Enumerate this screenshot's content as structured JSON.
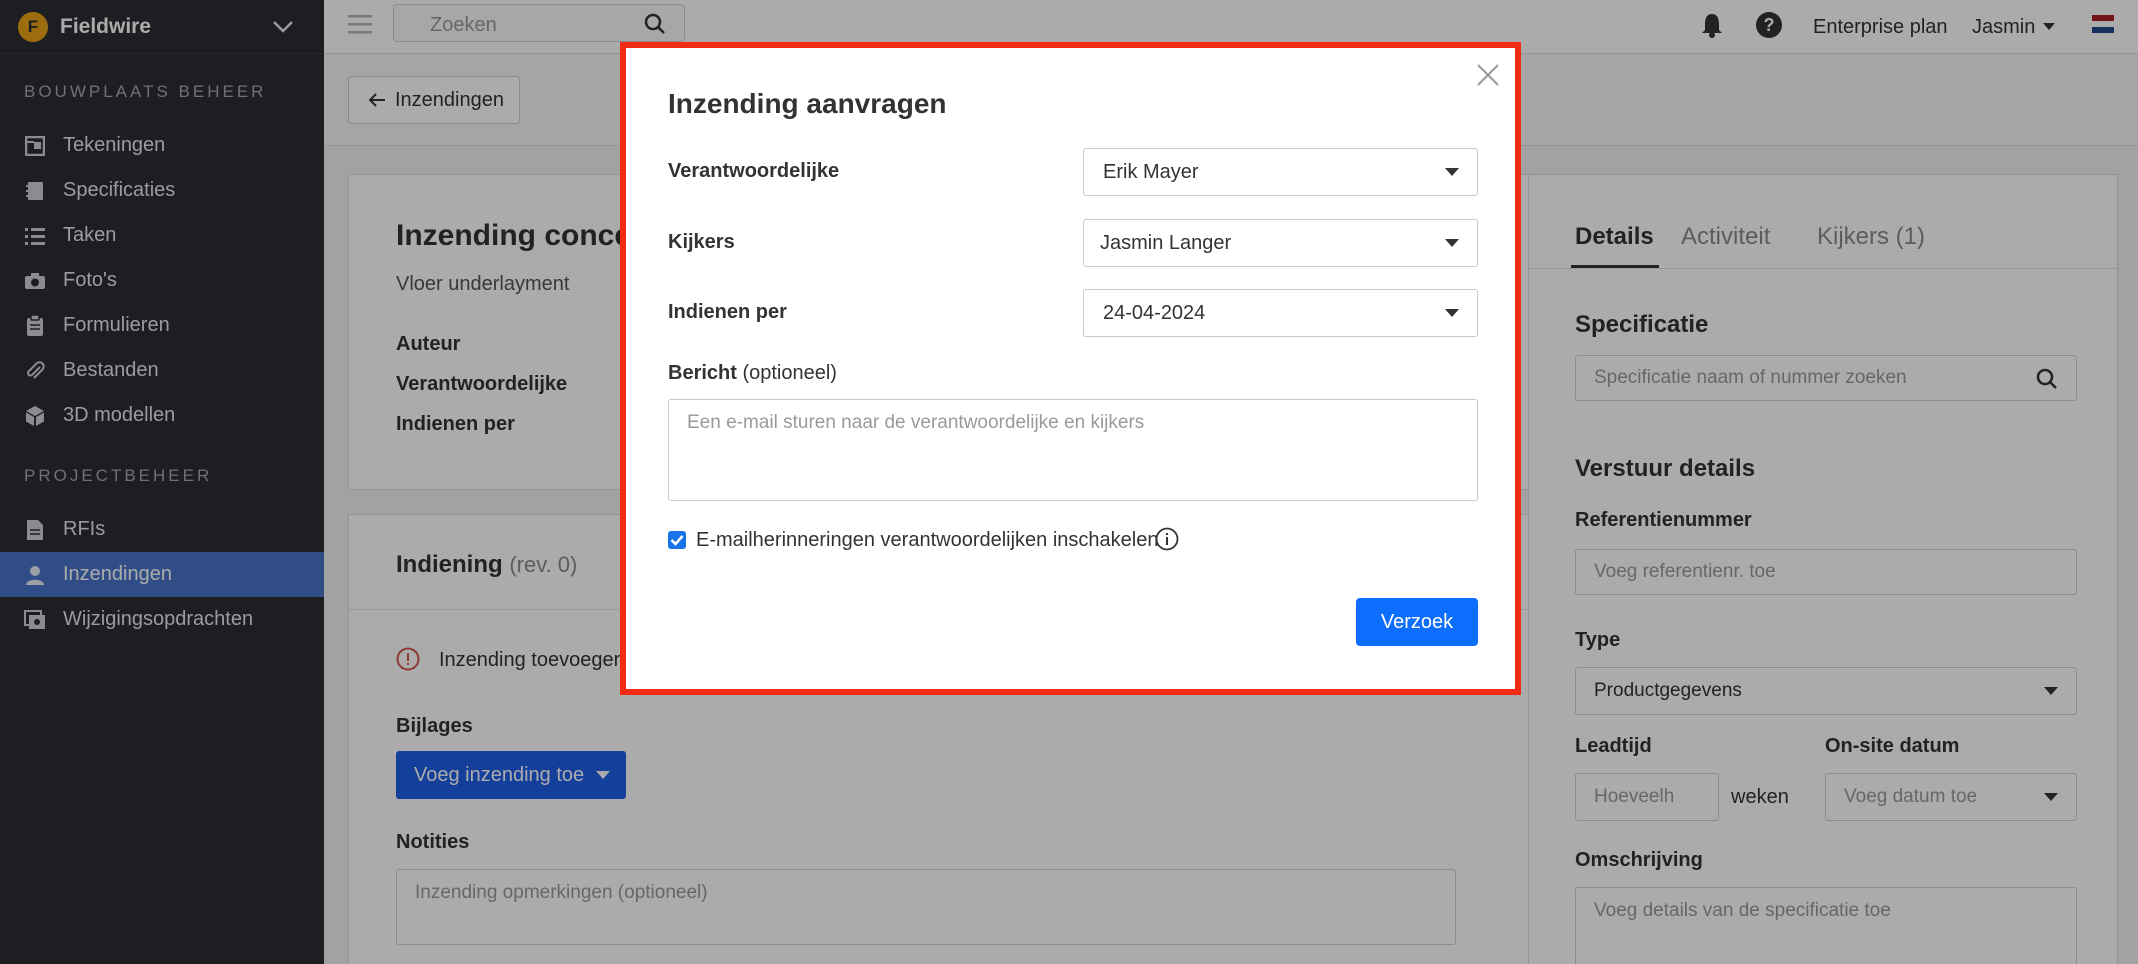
{
  "app": {
    "name": "Fieldwire",
    "logo_letter": "F"
  },
  "sidebar": {
    "section1_title": "BOUWPLAATS BEHEER",
    "section2_title": "PROJECTBEHEER",
    "items": [
      {
        "label": "Tekeningen",
        "icon": "plans-icon"
      },
      {
        "label": "Specificaties",
        "icon": "spec-book-icon"
      },
      {
        "label": "Taken",
        "icon": "list-icon"
      },
      {
        "label": "Foto's",
        "icon": "camera-icon"
      },
      {
        "label": "Formulieren",
        "icon": "clipboard-icon"
      },
      {
        "label": "Bestanden",
        "icon": "paperclip-icon"
      },
      {
        "label": "3D modellen",
        "icon": "cube-icon"
      },
      {
        "label": "RFIs",
        "icon": "document-icon"
      },
      {
        "label": "Inzendingen",
        "icon": "person-icon",
        "active": true
      },
      {
        "label": "Wijzigingsopdrachten",
        "icon": "change-order-icon"
      }
    ]
  },
  "topbar": {
    "search_placeholder": "Zoeken",
    "plan": "Enterprise plan",
    "user": "Jasmin"
  },
  "page": {
    "back_label": "Inzendingen",
    "title": "Inzending concep",
    "subtitle": "Vloer underlayment",
    "meta_labels": [
      "Auteur",
      "Verantwoordelijke",
      "Indienen per"
    ],
    "indiening_title": "Indiening",
    "indiening_rev": "(rev. 0)",
    "warning_text": "Inzending toevoegen",
    "bijlages_label": "Bijlages",
    "add_submission_button": "Voeg inzending toe",
    "notities_label": "Notities",
    "notities_placeholder": "Inzending opmerkingen (optioneel)"
  },
  "details": {
    "tabs": [
      "Details",
      "Activiteit",
      "Kijkers (1)"
    ],
    "spec_title": "Specificatie",
    "spec_search_placeholder": "Specificatie naam of nummer zoeken",
    "send_details_title": "Verstuur details",
    "ref_label": "Referentienummer",
    "ref_placeholder": "Voeg referentienr. toe",
    "type_label": "Type",
    "type_value": "Productgegevens",
    "leadtime_label": "Leadtijd",
    "leadtime_placeholder": "Hoeveelh",
    "weeks_label": "weken",
    "onsite_label": "On-site datum",
    "onsite_placeholder": "Voeg datum toe",
    "description_label": "Omschrijving",
    "description_placeholder": "Voeg details van de specificatie toe"
  },
  "modal": {
    "title": "Inzending aanvragen",
    "responsible_label": "Verantwoordelijke",
    "responsible_value": "Erik Mayer",
    "viewers_label": "Kijkers",
    "viewers_value": "Jasmin Langer",
    "due_label": "Indienen per",
    "due_value": "24-04-2024",
    "message_label": "Bericht",
    "message_optional": "(optioneel)",
    "message_placeholder": "Een e-mail sturen naar de verantwoordelijke en kijkers",
    "reminder_label": "E-mailherinneringen verantwoordelijken inschakelen",
    "reminder_checked": true,
    "submit_label": "Verzoek"
  },
  "colors": {
    "sidebar_bg": "#2b2d33",
    "active_nav": "#4a73c9",
    "primary_button": "#0d6efd",
    "highlight_frame": "#f22b14"
  }
}
